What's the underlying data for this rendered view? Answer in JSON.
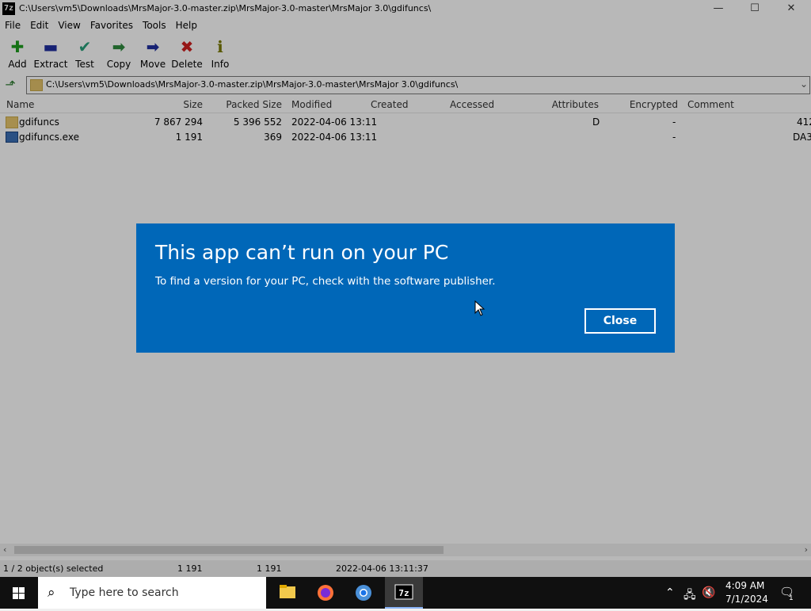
{
  "window": {
    "app_icon": "7z",
    "title": "C:\\Users\\vm5\\Downloads\\MrsMajor-3.0-master.zip\\MrsMajor-3.0-master\\MrsMajor 3.0\\gdifuncs\\",
    "controls": {
      "minimize": "—",
      "maximize": "☐",
      "close": "✕"
    }
  },
  "menu": [
    "File",
    "Edit",
    "View",
    "Favorites",
    "Tools",
    "Help"
  ],
  "toolbar": [
    {
      "label": "Add",
      "icon": "add-icon",
      "glyph": "✚",
      "color": "#1e9e1e"
    },
    {
      "label": "Extract",
      "icon": "extract-icon",
      "glyph": "▬",
      "color": "#1f2fa0"
    },
    {
      "label": "Test",
      "icon": "test-icon",
      "glyph": "✔",
      "color": "#27a07a"
    },
    {
      "label": "Copy",
      "icon": "copy-icon",
      "glyph": "➡",
      "color": "#2e8b3e"
    },
    {
      "label": "Move",
      "icon": "move-icon",
      "glyph": "➡",
      "color": "#1f2fa0"
    },
    {
      "label": "Delete",
      "icon": "delete-icon",
      "glyph": "✖",
      "color": "#d02020"
    },
    {
      "label": "Info",
      "icon": "info-icon",
      "glyph": "ℹ",
      "color": "#7a7a00"
    }
  ],
  "address": {
    "path": "C:\\Users\\vm5\\Downloads\\MrsMajor-3.0-master.zip\\MrsMajor-3.0-master\\MrsMajor 3.0\\gdifuncs\\"
  },
  "columns": [
    "Name",
    "Size",
    "Packed Size",
    "Modified",
    "Created",
    "Accessed",
    "Attributes",
    "Encrypted",
    "Comment"
  ],
  "rows": [
    {
      "name": "gdifuncs",
      "type": "folder",
      "size": "7 867 294",
      "packed": "5 396 552",
      "modified": "2022-04-06 13:11",
      "created": "",
      "accessed": "",
      "attributes": "D",
      "encrypted": "-",
      "comment": "",
      "extra": "412"
    },
    {
      "name": "gdifuncs.exe",
      "type": "exe",
      "size": "1 191",
      "packed": "369",
      "modified": "2022-04-06 13:11",
      "created": "",
      "accessed": "",
      "attributes": "",
      "encrypted": "-",
      "comment": "",
      "extra": "DA3"
    }
  ],
  "status": {
    "selection": "1 / 2 object(s) selected",
    "size": "1 191",
    "packed": "1 191",
    "modified": "2022-04-06 13:11:37"
  },
  "dialog": {
    "title": "This app can’t run on your PC",
    "message": "To find a version for your PC, check with the software publisher.",
    "close_label": "Close",
    "bg_color": "#0067b8"
  },
  "taskbar": {
    "search_placeholder": "Type here to search",
    "time": "4:09 AM",
    "date": "7/1/2024",
    "notification_count": "1"
  }
}
